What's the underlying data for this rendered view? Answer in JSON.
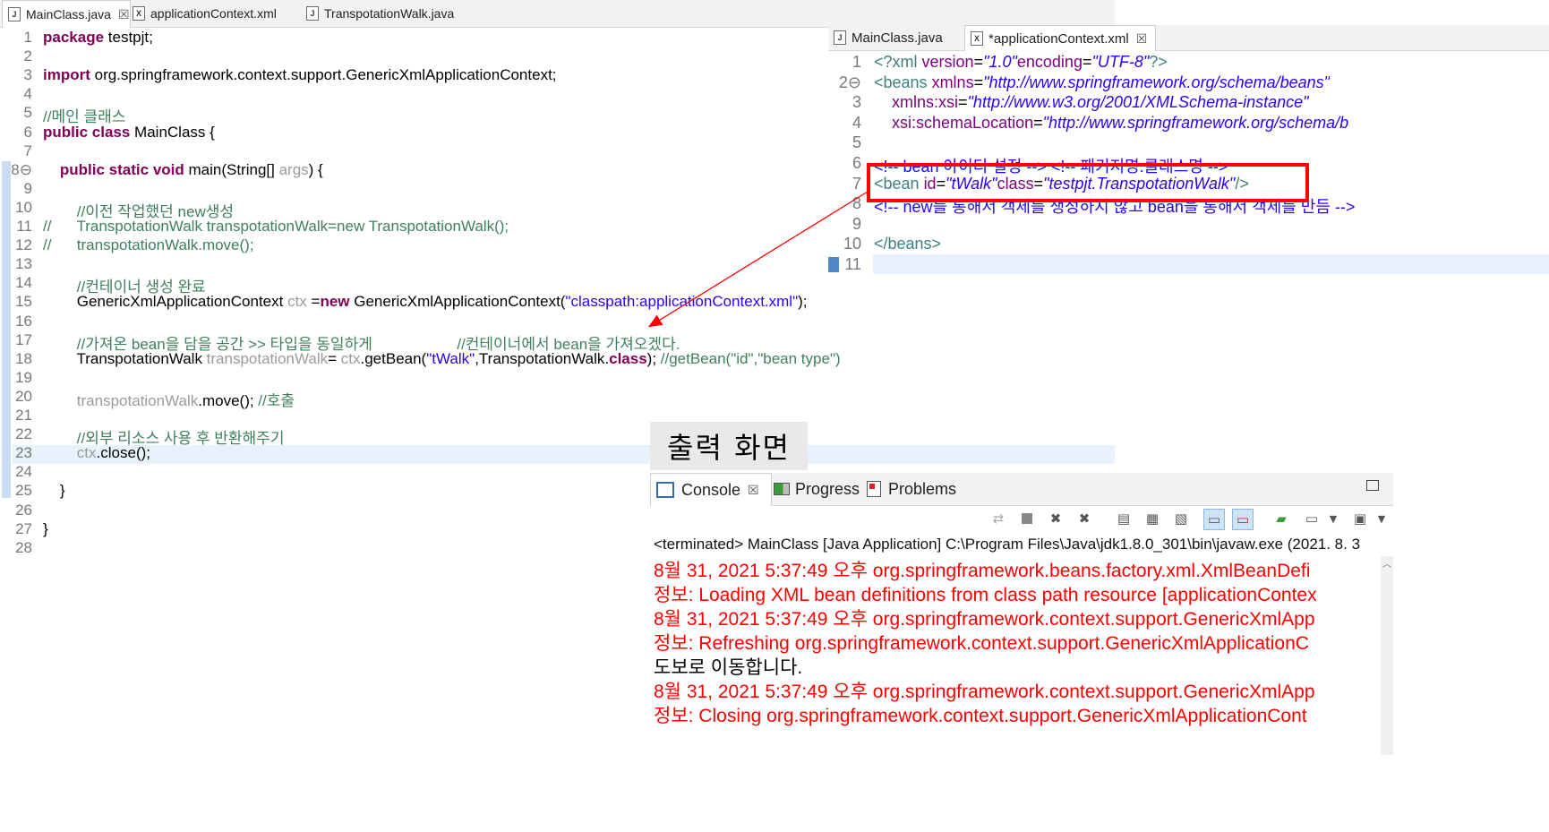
{
  "left_editor": {
    "tabs": [
      {
        "label": "MainClass.java",
        "active": true,
        "icon": "J",
        "close": "☒"
      },
      {
        "label": "applicationContext.xml",
        "active": false,
        "icon": "X"
      },
      {
        "label": "TranspotationWalk.java",
        "active": false,
        "icon": "J"
      }
    ],
    "lines": [
      {
        "n": "1",
        "segs": [
          {
            "c": "kw",
            "t": "package"
          },
          {
            "c": "",
            "t": " testpjt;"
          }
        ]
      },
      {
        "n": "2",
        "segs": []
      },
      {
        "n": "3",
        "segs": [
          {
            "c": "kw",
            "t": "import"
          },
          {
            "c": "",
            "t": " org.springframework.context.support.GenericXmlApplicationContext;"
          }
        ]
      },
      {
        "n": "4",
        "segs": []
      },
      {
        "n": "5",
        "segs": [
          {
            "c": "cm",
            "t": "//메인 클래스"
          }
        ]
      },
      {
        "n": "6",
        "segs": [
          {
            "c": "kw",
            "t": "public class"
          },
          {
            "c": "",
            "t": " MainClass {"
          }
        ]
      },
      {
        "n": "7",
        "segs": []
      },
      {
        "n": "8⊖",
        "segs": [
          {
            "c": "",
            "t": "    "
          },
          {
            "c": "kw",
            "t": "public static void"
          },
          {
            "c": "",
            "t": " main(String[] "
          },
          {
            "c": "gray",
            "t": "args"
          },
          {
            "c": "",
            "t": ") {"
          }
        ]
      },
      {
        "n": "9",
        "segs": []
      },
      {
        "n": "10",
        "segs": [
          {
            "c": "",
            "t": "        "
          },
          {
            "c": "cm",
            "t": "//이전 작업했던 new생성"
          }
        ]
      },
      {
        "n": "11",
        "segs": [
          {
            "c": "cm",
            "t": "//      TranspotationWalk transpotationWalk=new TranspotationWalk();"
          }
        ]
      },
      {
        "n": "12",
        "segs": [
          {
            "c": "cm",
            "t": "//      transpotationWalk.move();"
          }
        ]
      },
      {
        "n": "13",
        "segs": []
      },
      {
        "n": "14",
        "segs": [
          {
            "c": "",
            "t": "        "
          },
          {
            "c": "cm",
            "t": "//컨테이너 생성 완료"
          }
        ]
      },
      {
        "n": "15",
        "segs": [
          {
            "c": "",
            "t": "        GenericXmlApplicationContext "
          },
          {
            "c": "gray",
            "t": "ctx"
          },
          {
            "c": "",
            "t": " ="
          },
          {
            "c": "kw",
            "t": "new"
          },
          {
            "c": "",
            "t": " GenericXmlApplicationContext("
          },
          {
            "c": "str",
            "t": "\"classpath:applicationContext.xml\""
          },
          {
            "c": "",
            "t": ");"
          }
        ]
      },
      {
        "n": "16",
        "segs": []
      },
      {
        "n": "17",
        "segs": [
          {
            "c": "",
            "t": "        "
          },
          {
            "c": "cm",
            "t": "//가져온 bean을 담을 공간 >> 타입을 동일하게                    //컨테이너에서 bean을 가져오겠다."
          }
        ]
      },
      {
        "n": "18",
        "segs": [
          {
            "c": "",
            "t": "        TranspotationWalk "
          },
          {
            "c": "gray",
            "t": "transpotationWalk"
          },
          {
            "c": "",
            "t": "= "
          },
          {
            "c": "gray",
            "t": "ctx"
          },
          {
            "c": "",
            "t": ".getBean("
          },
          {
            "c": "str",
            "t": "\"tWalk\""
          },
          {
            "c": "",
            "t": ",TranspotationWalk."
          },
          {
            "c": "kw",
            "t": "class"
          },
          {
            "c": "",
            "t": "); "
          },
          {
            "c": "cm",
            "t": "//getBean(\"id\",\"bean type\")"
          }
        ]
      },
      {
        "n": "19",
        "segs": []
      },
      {
        "n": "20",
        "segs": [
          {
            "c": "",
            "t": "        "
          },
          {
            "c": "gray",
            "t": "transpotationWalk"
          },
          {
            "c": "",
            "t": ".move(); "
          },
          {
            "c": "cm",
            "t": "//호출"
          }
        ]
      },
      {
        "n": "21",
        "segs": []
      },
      {
        "n": "22",
        "segs": [
          {
            "c": "",
            "t": "        "
          },
          {
            "c": "cm",
            "t": "//외부 리소스 사용 후 반환해주기"
          }
        ]
      },
      {
        "n": "23",
        "segs": [
          {
            "c": "",
            "t": "        "
          },
          {
            "c": "gray",
            "t": "ctx"
          },
          {
            "c": "",
            "t": ".close();"
          }
        ]
      },
      {
        "n": "24",
        "segs": []
      },
      {
        "n": "25",
        "segs": [
          {
            "c": "",
            "t": "    }"
          }
        ]
      },
      {
        "n": "26",
        "segs": []
      },
      {
        "n": "27",
        "segs": [
          {
            "c": "",
            "t": "}"
          }
        ]
      },
      {
        "n": "28",
        "segs": []
      }
    ]
  },
  "right_editor": {
    "tabs": [
      {
        "label": "MainClass.java",
        "active": false,
        "icon": "J"
      },
      {
        "label": "*applicationContext.xml",
        "active": true,
        "icon": "X",
        "close": "☒"
      }
    ],
    "lines": [
      {
        "n": "1",
        "segs": [
          {
            "c": "xmlt",
            "t": "<?xml "
          },
          {
            "c": "xmla",
            "t": "version"
          },
          {
            "c": "",
            "t": "="
          },
          {
            "c": "xmlv",
            "t": "\"1.0\""
          },
          {
            "c": "xmla",
            "t": "encoding"
          },
          {
            "c": "",
            "t": "="
          },
          {
            "c": "xmlv",
            "t": "\"UTF-8\""
          },
          {
            "c": "xmlt",
            "t": "?>"
          }
        ]
      },
      {
        "n": "2⊖",
        "segs": [
          {
            "c": "xmlt",
            "t": "<beans "
          },
          {
            "c": "xmla",
            "t": "xmlns"
          },
          {
            "c": "",
            "t": "="
          },
          {
            "c": "xmlv",
            "t": "\"http://www.springframework.org/schema/beans\""
          }
        ]
      },
      {
        "n": "3",
        "segs": [
          {
            "c": "",
            "t": "    "
          },
          {
            "c": "xmla",
            "t": "xmlns:xsi"
          },
          {
            "c": "",
            "t": "="
          },
          {
            "c": "xmlv",
            "t": "\"http://www.w3.org/2001/XMLSchema-instance\""
          }
        ]
      },
      {
        "n": "4",
        "segs": [
          {
            "c": "",
            "t": "    "
          },
          {
            "c": "xmla",
            "t": "xsi:schemaLocation"
          },
          {
            "c": "",
            "t": "="
          },
          {
            "c": "xmlv",
            "t": "\"http://www.springframework.org/schema/b"
          }
        ]
      },
      {
        "n": "5",
        "segs": []
      },
      {
        "n": "6",
        "segs": [
          {
            "c": "str",
            "t": "<!-- bean 아이디 설정 --> <!-- 패키지명.클래스명 -->"
          }
        ]
      },
      {
        "n": "7",
        "segs": [
          {
            "c": "xmlt",
            "t": "<bean "
          },
          {
            "c": "xmla",
            "t": "id"
          },
          {
            "c": "",
            "t": "="
          },
          {
            "c": "xmlv",
            "t": "\"tWalk\""
          },
          {
            "c": "xmla",
            "t": "class"
          },
          {
            "c": "",
            "t": "="
          },
          {
            "c": "xmlv",
            "t": "\"testpjt.TranspotationWalk\""
          },
          {
            "c": "xmlt",
            "t": "/>"
          }
        ]
      },
      {
        "n": "8",
        "segs": [
          {
            "c": "str",
            "t": "<!-- new를 통해서 객체를 생성하지 않고 bean을 통해서 객체를 만듬 -->"
          }
        ]
      },
      {
        "n": "9",
        "segs": []
      },
      {
        "n": "10",
        "segs": [
          {
            "c": "xmlt",
            "t": "</beans>"
          }
        ]
      },
      {
        "n": "11",
        "segs": []
      }
    ]
  },
  "output_label": "출력 화면",
  "console": {
    "tabs": [
      {
        "label": "Console",
        "icon": "console-icon",
        "close": "☒"
      },
      {
        "label": "Progress",
        "icon": "progress-icon"
      },
      {
        "label": "Problems",
        "icon": "problems-icon"
      }
    ],
    "status": "<terminated> MainClass [Java Application] C:\\Program Files\\Java\\jdk1.8.0_301\\bin\\javaw.exe  (2021. 8. 3",
    "lines": [
      {
        "color": "red",
        "text": "8월 31, 2021 5:37:49 오후 org.springframework.beans.factory.xml.XmlBeanDefi"
      },
      {
        "color": "red",
        "text": "정보: Loading XML bean definitions from class path resource [applicationContex"
      },
      {
        "color": "red",
        "text": "8월 31, 2021 5:37:49 오후 org.springframework.context.support.GenericXmlApp"
      },
      {
        "color": "red",
        "text": "정보: Refreshing org.springframework.context.support.GenericXmlApplicationC"
      },
      {
        "color": "black",
        "text": "도보로 이동합니다."
      },
      {
        "color": "red",
        "text": "8월 31, 2021 5:37:49 오후 org.springframework.context.support.GenericXmlApp"
      },
      {
        "color": "red",
        "text": "정보: Closing org.springframework.context.support.GenericXmlApplicationCont"
      }
    ]
  },
  "colors": {
    "highlight_box": "#ff0000",
    "arrow": "#ff0000",
    "console_error": "#ff0000"
  }
}
